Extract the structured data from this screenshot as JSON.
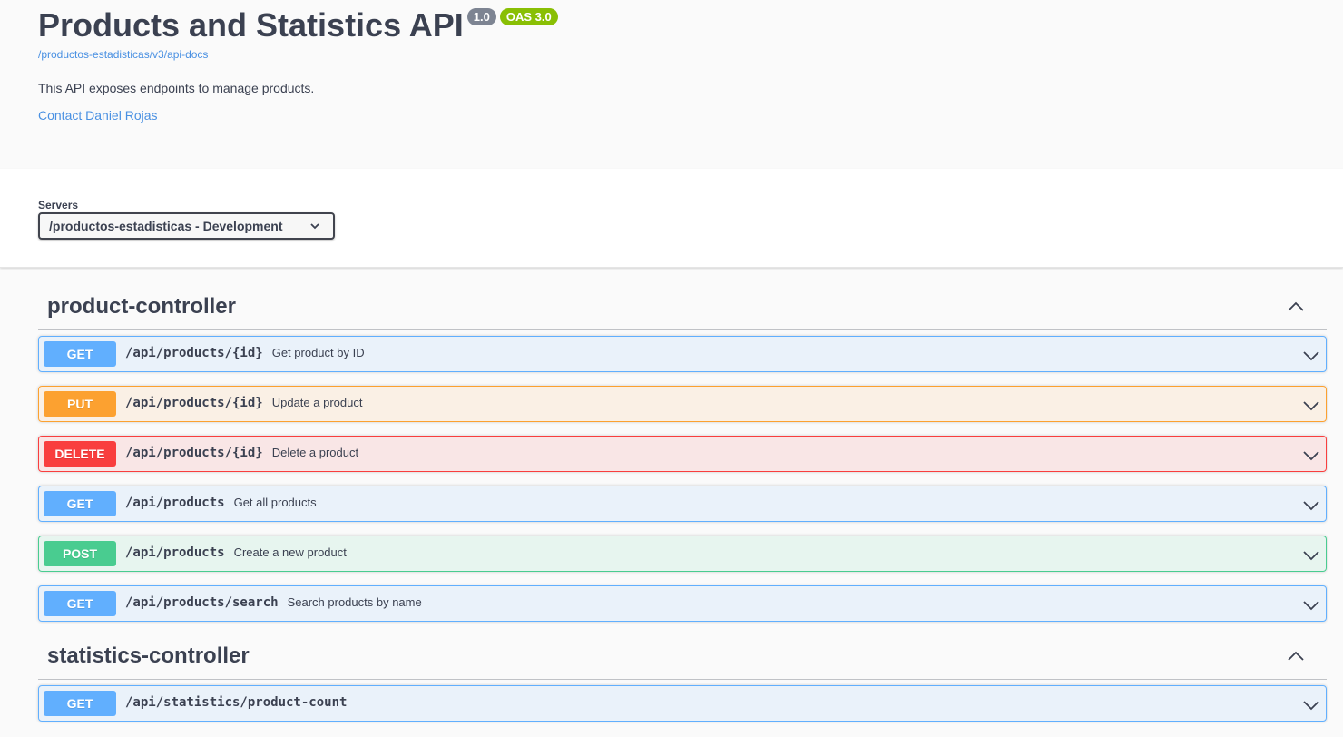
{
  "info": {
    "title": "Products and Statistics API",
    "version_badge": "1.0",
    "oas_badge": "OAS 3.0",
    "spec_link": "/productos-estadisticas/v3/api-docs",
    "description": "This API exposes endpoints to manage products.",
    "contact_link": "Contact Daniel Rojas"
  },
  "servers": {
    "label": "Servers",
    "selected": "/productos-estadisticas - Development"
  },
  "sections": [
    {
      "name": "product-controller",
      "operations": [
        {
          "method": "GET",
          "path": "/api/products/{id}",
          "summary": "Get product by ID"
        },
        {
          "method": "PUT",
          "path": "/api/products/{id}",
          "summary": "Update a product"
        },
        {
          "method": "DELETE",
          "path": "/api/products/{id}",
          "summary": "Delete a product"
        },
        {
          "method": "GET",
          "path": "/api/products",
          "summary": "Get all products"
        },
        {
          "method": "POST",
          "path": "/api/products",
          "summary": "Create a new product"
        },
        {
          "method": "GET",
          "path": "/api/products/search",
          "summary": "Search products by name"
        }
      ]
    },
    {
      "name": "statistics-controller",
      "operations": [
        {
          "method": "GET",
          "path": "/api/statistics/product-count",
          "summary": ""
        }
      ]
    }
  ],
  "colors": {
    "get": "#61affe",
    "put": "#fca130",
    "delete": "#f93e3e",
    "post": "#49cc90",
    "link": "#4990e2",
    "version_badge": "#7d8492",
    "oas_badge": "#89bf04"
  }
}
